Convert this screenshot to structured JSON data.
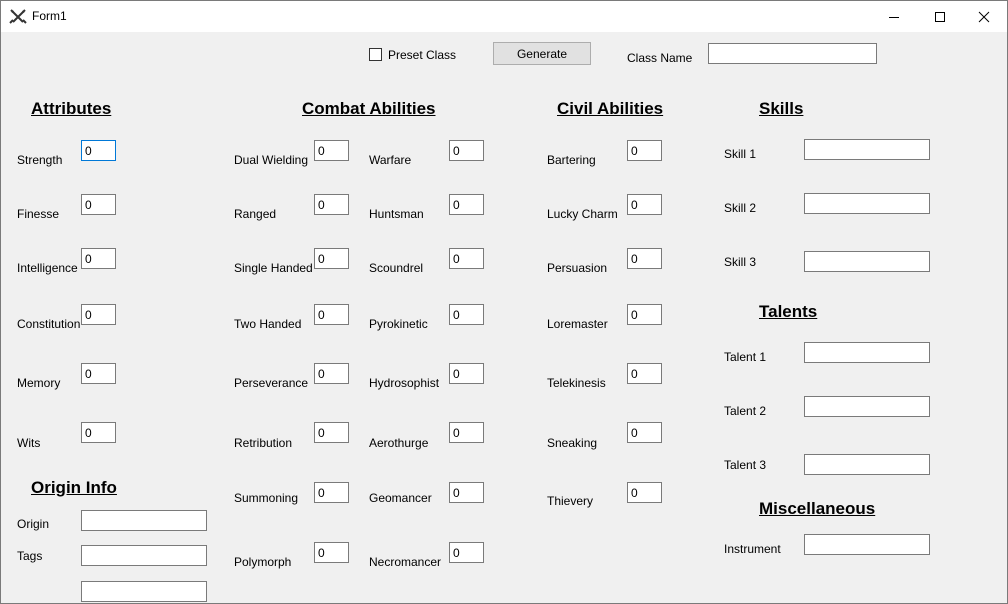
{
  "window": {
    "title": "Form1",
    "minimize_icon": "minimize-icon",
    "maximize_icon": "maximize-icon",
    "close_icon": "close-icon"
  },
  "toolbar": {
    "preset_label": "Preset Class",
    "preset_checked": false,
    "generate_label": "Generate",
    "class_name_label": "Class Name",
    "class_name_value": ""
  },
  "attributes": {
    "header": "Attributes",
    "fields": [
      {
        "label": "Strength",
        "value": "0"
      },
      {
        "label": "Finesse",
        "value": "0"
      },
      {
        "label": "Intelligence",
        "value": "0"
      },
      {
        "label": "Constitution",
        "value": "0"
      },
      {
        "label": "Memory",
        "value": "0"
      },
      {
        "label": "Wits",
        "value": "0"
      }
    ]
  },
  "origin": {
    "header": "Origin Info",
    "origin_label": "Origin",
    "origin_value": "",
    "tags_label": "Tags",
    "tags_value": "",
    "tags2_value": ""
  },
  "combat": {
    "header": "Combat Abilities",
    "left": [
      {
        "label": "Dual Wielding",
        "value": "0"
      },
      {
        "label": "Ranged",
        "value": "0"
      },
      {
        "label": "Single Handed",
        "value": "0"
      },
      {
        "label": "Two Handed",
        "value": "0"
      },
      {
        "label": "Perseverance",
        "value": "0"
      },
      {
        "label": "Retribution",
        "value": "0"
      },
      {
        "label": "Summoning",
        "value": "0"
      },
      {
        "label": "Polymorph",
        "value": "0"
      }
    ],
    "right": [
      {
        "label": "Warfare",
        "value": "0"
      },
      {
        "label": "Huntsman",
        "value": "0"
      },
      {
        "label": "Scoundrel",
        "value": "0"
      },
      {
        "label": "Pyrokinetic",
        "value": "0"
      },
      {
        "label": "Hydrosophist",
        "value": "0"
      },
      {
        "label": "Aerothurge",
        "value": "0"
      },
      {
        "label": "Geomancer",
        "value": "0"
      },
      {
        "label": "Necromancer",
        "value": "0"
      }
    ]
  },
  "civil": {
    "header": "Civil Abilities",
    "fields": [
      {
        "label": "Bartering",
        "value": "0"
      },
      {
        "label": "Lucky Charm",
        "value": "0"
      },
      {
        "label": "Persuasion",
        "value": "0"
      },
      {
        "label": "Loremaster",
        "value": "0"
      },
      {
        "label": "Telekinesis",
        "value": "0"
      },
      {
        "label": "Sneaking",
        "value": "0"
      },
      {
        "label": "Thievery",
        "value": "0"
      }
    ]
  },
  "skills": {
    "header": "Skills",
    "fields": [
      {
        "label": "Skill 1",
        "value": ""
      },
      {
        "label": "Skill 2",
        "value": ""
      },
      {
        "label": "Skill 3",
        "value": ""
      }
    ]
  },
  "talents": {
    "header": "Talents",
    "fields": [
      {
        "label": "Talent 1",
        "value": ""
      },
      {
        "label": "Talent 2",
        "value": ""
      },
      {
        "label": "Talent 3",
        "value": ""
      }
    ]
  },
  "misc": {
    "header": "Miscellaneous",
    "instrument_label": "Instrument",
    "instrument_value": ""
  }
}
